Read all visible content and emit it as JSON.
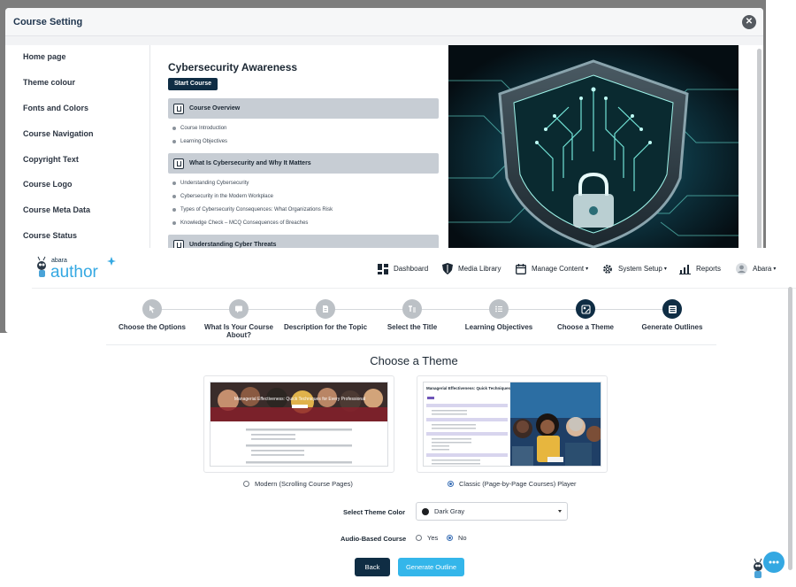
{
  "course_setting": {
    "title": "Course Setting",
    "close_symbol": "✕",
    "menu": [
      "Home page",
      "Theme colour",
      "Fonts and Colors",
      "Course Navigation",
      "Copyright Text",
      "Course Logo",
      "Course Meta Data",
      "Course Status"
    ],
    "preview": {
      "course_title": "Cybersecurity Awareness",
      "start_label": "Start Course",
      "sections": [
        {
          "title": "Course Overview",
          "lessons": [
            "Course Introduction",
            "Learning Objectives"
          ]
        },
        {
          "title": "What Is Cybersecurity and Why It Matters",
          "lessons": [
            "Understanding Cybersecurity",
            "Cybersecurity in the Modern Workplace",
            "Types of Cybersecurity Consequences: What Organizations Risk",
            "Knowledge Check – MCQ Consequences of Breaches"
          ]
        },
        {
          "title": "Understanding Cyber Threats",
          "lessons": []
        }
      ]
    }
  },
  "app": {
    "brand_small": "abara",
    "brand_large": "author",
    "nav": {
      "dashboard": "Dashboard",
      "media_library": "Media Library",
      "manage_content": "Manage Content",
      "system_setup": "System Setup",
      "reports": "Reports",
      "user": "Abara"
    },
    "steps": [
      {
        "label": "Choose the Options",
        "icon": "cursor-icon"
      },
      {
        "label": "What Is Your Course About?",
        "icon": "chat-icon"
      },
      {
        "label": "Description for the Topic",
        "icon": "document-icon"
      },
      {
        "label": "Select the Title",
        "icon": "title-icon"
      },
      {
        "label": "Learning Objectives",
        "icon": "list-icon"
      },
      {
        "label": "Choose a Theme",
        "icon": "theme-icon"
      },
      {
        "label": "Generate Outlines",
        "icon": "outline-icon"
      }
    ],
    "active_step": 6,
    "page_heading": "Choose a Theme",
    "themes": [
      {
        "label": "Modern (Scrolling Course Pages)",
        "selected": false,
        "preview_title": "Managerial Effectiveness: Quick Techniques for Every Professional"
      },
      {
        "label": "Classic (Page-by-Page Courses) Player",
        "selected": true,
        "preview_title": "Managerial Effectiveness: Quick Techniques for Every Professional."
      }
    ],
    "theme_color": {
      "label": "Select Theme Color",
      "value": "Dark Gray",
      "swatch": "#1d1f22"
    },
    "audio": {
      "label": "Audio-Based Course",
      "yes": "Yes",
      "no": "No",
      "selected": "No"
    },
    "buttons": {
      "back": "Back",
      "generate": "Generate Outline"
    },
    "colors": {
      "primary": "#0f2d44",
      "accent": "#34b6ea",
      "step_inactive": "#bcc1c6"
    }
  }
}
